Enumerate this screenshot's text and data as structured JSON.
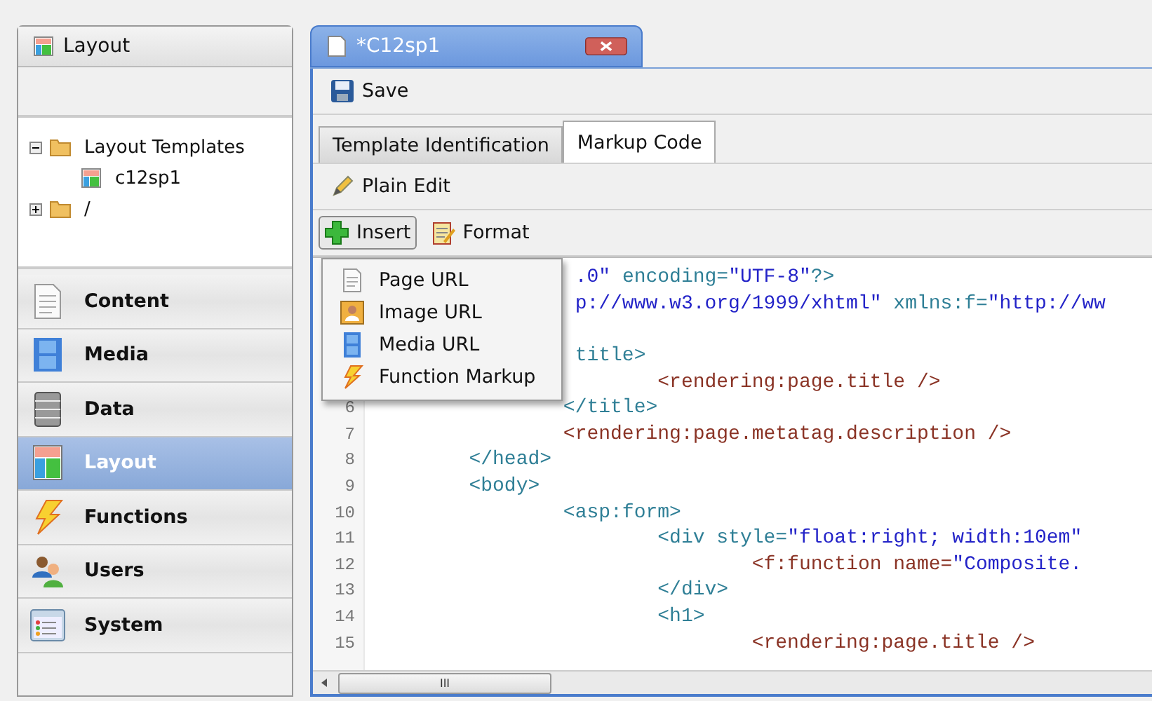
{
  "left_panel": {
    "title": "Layout",
    "tree": [
      {
        "label": "Layout Templates",
        "kind": "folder",
        "expanded": true,
        "children": [
          {
            "label": "c12sp1",
            "kind": "layout"
          }
        ]
      },
      {
        "label": "/",
        "kind": "folder",
        "expanded": false
      }
    ],
    "nav": [
      {
        "label": "Content",
        "kind": "content",
        "selected": false
      },
      {
        "label": "Media",
        "kind": "media",
        "selected": false
      },
      {
        "label": "Data",
        "kind": "data",
        "selected": false
      },
      {
        "label": "Layout",
        "kind": "layout",
        "selected": true
      },
      {
        "label": "Functions",
        "kind": "functions",
        "selected": false
      },
      {
        "label": "Users",
        "kind": "users",
        "selected": false
      },
      {
        "label": "System",
        "kind": "system",
        "selected": false
      }
    ]
  },
  "document_tab": {
    "title": "*C12sp1"
  },
  "toolbar": {
    "save": "Save"
  },
  "tabs": [
    {
      "label": "Template Identification",
      "selected": false
    },
    {
      "label": "Markup Code",
      "selected": true
    }
  ],
  "plain_edit": "Plain Edit",
  "insert": "Insert",
  "format": "Format",
  "insert_menu": [
    {
      "label": "Page URL",
      "kind": "page"
    },
    {
      "label": "Image URL",
      "kind": "image"
    },
    {
      "label": "Media URL",
      "kind": "media"
    },
    {
      "label": "Function Markup",
      "kind": "function"
    }
  ],
  "code_lines": [
    {
      "segments": [
        {
          "text": "                 .0\"",
          "kind": "string"
        },
        {
          "text": " encoding=",
          "kind": "markup"
        },
        {
          "text": "\"UTF-8\"",
          "kind": "string"
        },
        {
          "text": "?>",
          "kind": "markup"
        }
      ]
    },
    {
      "segments": [
        {
          "text": "                 p://www.w3.org/1999/xhtml\"",
          "kind": "string"
        },
        {
          "text": " xmlns:f=",
          "kind": "markup"
        },
        {
          "text": "\"http://ww",
          "kind": "string"
        }
      ]
    },
    {
      "kind": "blank"
    },
    {
      "segments": [
        {
          "text": "                 title>",
          "kind": "markup"
        }
      ]
    },
    {
      "segments": [
        {
          "text": "                        <rendering:page.title />",
          "kind": "render"
        }
      ]
    },
    {
      "number": "6",
      "segments": [
        {
          "text": "                </title>",
          "kind": "markup"
        }
      ]
    },
    {
      "number": "7",
      "segments": [
        {
          "text": "                <rendering:page.metatag.description />",
          "kind": "render"
        }
      ]
    },
    {
      "number": "8",
      "segments": [
        {
          "text": "        </head>",
          "kind": "markup"
        }
      ]
    },
    {
      "number": "9",
      "segments": [
        {
          "text": "        <body>",
          "kind": "markup"
        }
      ]
    },
    {
      "number": "10",
      "segments": [
        {
          "text": "                <asp:form>",
          "kind": "markup"
        }
      ]
    },
    {
      "number": "11",
      "segments": [
        {
          "text": "                        <div style=",
          "kind": "markup"
        },
        {
          "text": "\"float:right; width:10em\"",
          "kind": "string"
        }
      ]
    },
    {
      "number": "12",
      "segments": [
        {
          "text": "                                <f:function name=",
          "kind": "render"
        },
        {
          "text": "\"Composite.",
          "kind": "string"
        }
      ]
    },
    {
      "number": "13",
      "segments": [
        {
          "text": "                        </div>",
          "kind": "markup"
        }
      ]
    },
    {
      "number": "14",
      "segments": [
        {
          "text": "                        <h1>",
          "kind": "markup"
        }
      ]
    },
    {
      "number": "15",
      "segments": [
        {
          "text": "                                <rendering:page.title />",
          "kind": "render"
        }
      ]
    }
  ],
  "scrollbar": {
    "grip": "III"
  }
}
